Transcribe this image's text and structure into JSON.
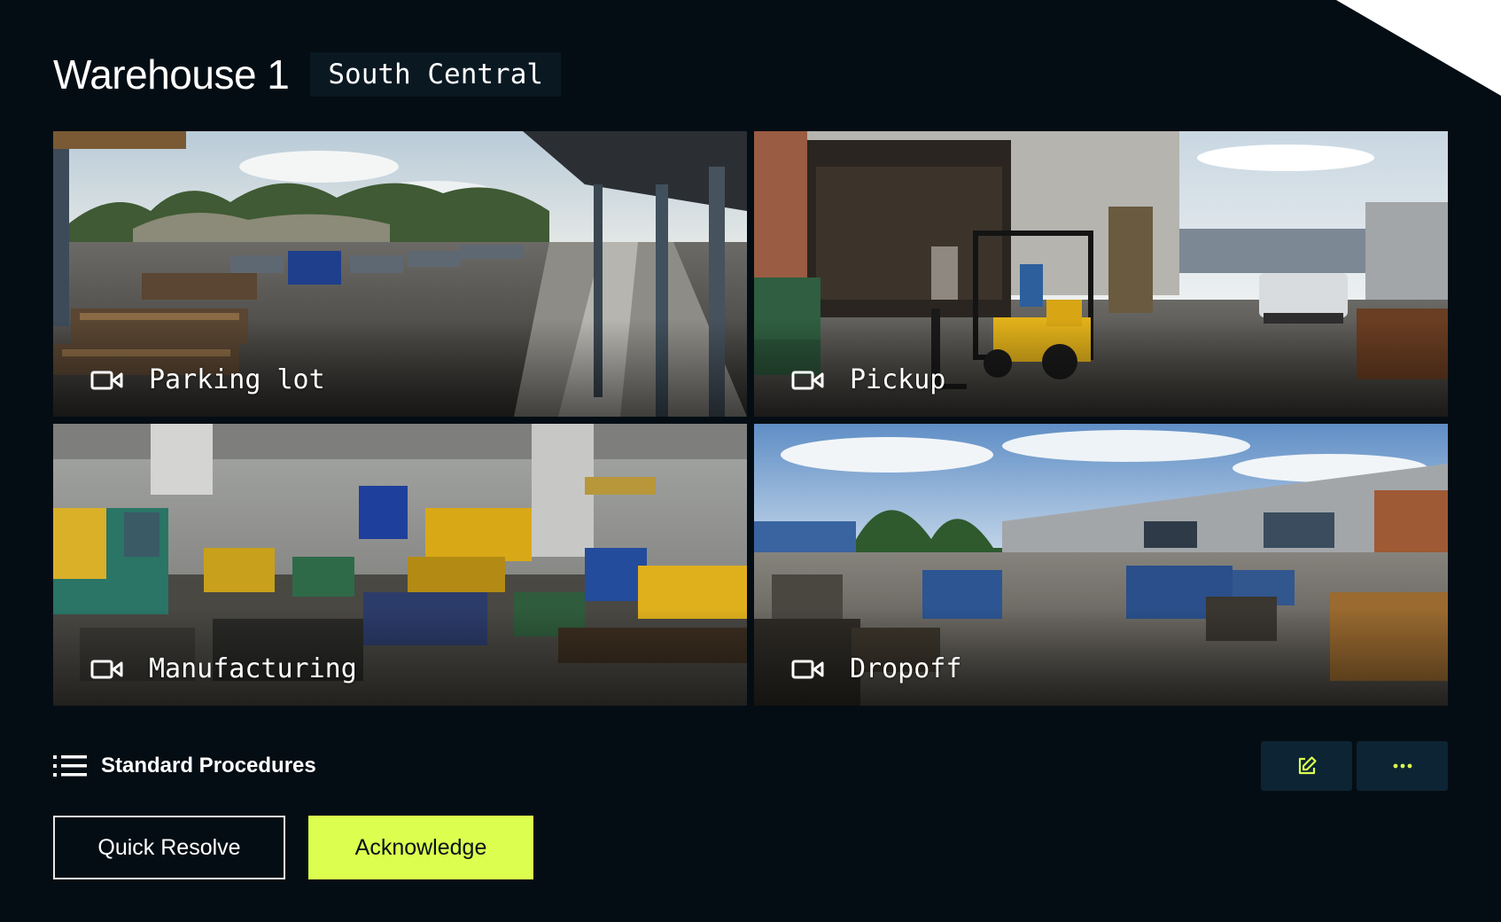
{
  "header": {
    "title": "Warehouse 1",
    "location": "South Central"
  },
  "feeds": [
    {
      "name": "Parking lot",
      "icon": "video-camera-icon"
    },
    {
      "name": "Pickup",
      "icon": "video-camera-icon"
    },
    {
      "name": "Manufacturing",
      "icon": "video-camera-icon"
    },
    {
      "name": "Dropoff",
      "icon": "video-camera-icon"
    }
  ],
  "procedures": {
    "label": "Standard Procedures",
    "icon": "list-icon"
  },
  "toolbar": {
    "edit_icon": "edit-icon",
    "more_icon": "more-icon"
  },
  "actions": {
    "quick_resolve": "Quick Resolve",
    "acknowledge": "Acknowledge"
  },
  "colors": {
    "background": "#050d14",
    "accent": "#dcff4f",
    "icon_button_bg": "#0d2434",
    "chip_bg": "#0a1822"
  }
}
